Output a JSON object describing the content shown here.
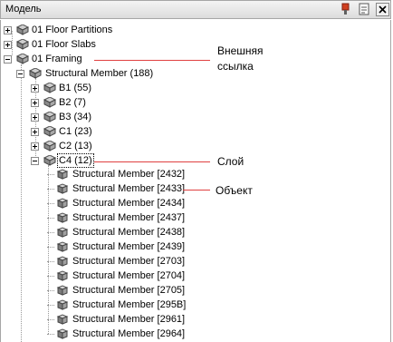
{
  "panel": {
    "title": "Модель"
  },
  "tree": {
    "root_items": [
      "01 Floor Partitions",
      "01 Floor Slabs",
      "01 Framing"
    ],
    "framing_child": "Structural Member (188)",
    "groups": [
      "B1 (55)",
      "B2 (7)",
      "B3 (34)",
      "C1 (23)",
      "C2 (13)",
      "C4 (12)"
    ],
    "members": [
      "Structural Member [2432]",
      "Structural Member [2433]",
      "Structural Member [2434]",
      "Structural Member [2437]",
      "Structural Member [2438]",
      "Structural Member [2439]",
      "Structural Member [2703]",
      "Structural Member [2704]",
      "Structural Member [2705]",
      "Structural Member [295B]",
      "Structural Member [2961]",
      "Structural Member [2964]"
    ]
  },
  "annotations": {
    "external_ref_line1": "Внешняя",
    "external_ref_line2": "ссылка",
    "layer": "Слой",
    "object": "Объект"
  }
}
